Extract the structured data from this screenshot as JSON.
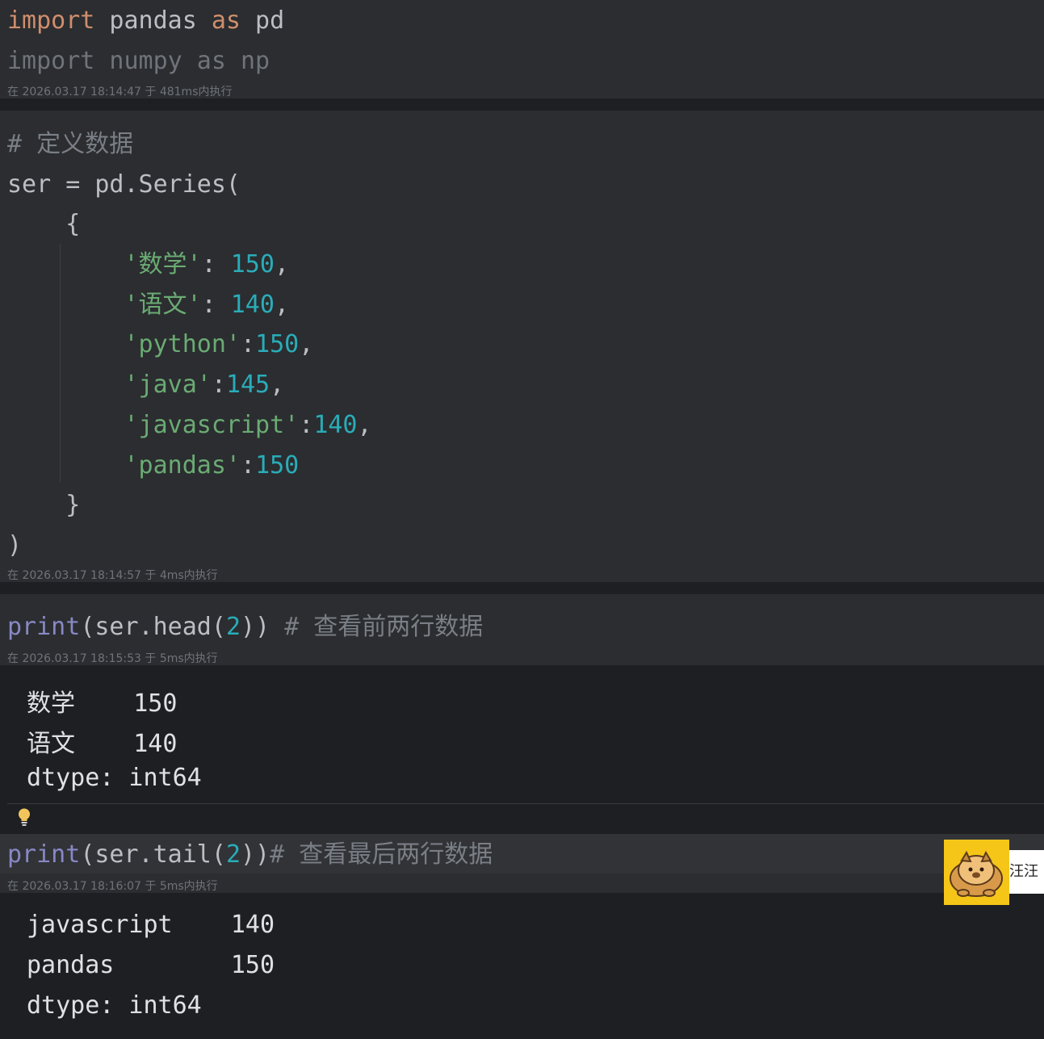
{
  "cells": [
    {
      "lines": [
        [
          {
            "t": "import",
            "c": "kw"
          },
          {
            "t": " pandas ",
            "c": "plain"
          },
          {
            "t": "as",
            "c": "kw"
          },
          {
            "t": " pd",
            "c": "plain"
          }
        ],
        [
          {
            "t": "import numpy as np",
            "c": "dim"
          }
        ]
      ],
      "meta": "在 2026.03.17 18:14:47 于 481ms内执行"
    },
    {
      "lines": [
        [
          {
            "t": "# 定义数据",
            "c": "comment"
          }
        ],
        [
          {
            "t": "ser = pd.Series(",
            "c": "plain"
          }
        ],
        [
          {
            "t": "    {",
            "c": "plain"
          }
        ],
        [
          {
            "t": "        ",
            "c": "plain"
          },
          {
            "t": "'数学'",
            "c": "str"
          },
          {
            "t": ": ",
            "c": "plain"
          },
          {
            "t": "150",
            "c": "num"
          },
          {
            "t": ",",
            "c": "plain"
          }
        ],
        [
          {
            "t": "        ",
            "c": "plain"
          },
          {
            "t": "'语文'",
            "c": "str"
          },
          {
            "t": ": ",
            "c": "plain"
          },
          {
            "t": "140",
            "c": "num"
          },
          {
            "t": ",",
            "c": "plain"
          }
        ],
        [
          {
            "t": "        ",
            "c": "plain"
          },
          {
            "t": "'python'",
            "c": "str"
          },
          {
            "t": ":",
            "c": "plain"
          },
          {
            "t": "150",
            "c": "num"
          },
          {
            "t": ",",
            "c": "plain"
          }
        ],
        [
          {
            "t": "        ",
            "c": "plain"
          },
          {
            "t": "'java'",
            "c": "str"
          },
          {
            "t": ":",
            "c": "plain"
          },
          {
            "t": "145",
            "c": "num"
          },
          {
            "t": ",",
            "c": "plain"
          }
        ],
        [
          {
            "t": "        ",
            "c": "plain"
          },
          {
            "t": "'javascript'",
            "c": "str"
          },
          {
            "t": ":",
            "c": "plain"
          },
          {
            "t": "140",
            "c": "num"
          },
          {
            "t": ",",
            "c": "plain"
          }
        ],
        [
          {
            "t": "        ",
            "c": "plain"
          },
          {
            "t": "'pandas'",
            "c": "str"
          },
          {
            "t": ":",
            "c": "plain"
          },
          {
            "t": "150",
            "c": "num"
          }
        ],
        [
          {
            "t": "    }",
            "c": "plain"
          }
        ],
        [
          {
            "t": ")",
            "c": "plain"
          }
        ]
      ],
      "meta": "在 2026.03.17 18:14:57 于 4ms内执行"
    },
    {
      "lines": [
        [
          {
            "t": "print",
            "c": "fn"
          },
          {
            "t": "(ser.head(",
            "c": "plain"
          },
          {
            "t": "2",
            "c": "num"
          },
          {
            "t": ")) ",
            "c": "plain"
          },
          {
            "t": "# 查看前两行数据",
            "c": "comment"
          }
        ]
      ],
      "meta": "在 2026.03.17 18:15:53 于 5ms内执行",
      "output": [
        "数学    150",
        "语文    140",
        "dtype: int64"
      ]
    },
    {
      "lines": [
        [
          {
            "t": "print",
            "c": "fn"
          },
          {
            "t": "(ser.tail(",
            "c": "plain"
          },
          {
            "t": "2",
            "c": "num"
          },
          {
            "t": "))",
            "c": "plain"
          },
          {
            "t": "# 查看最后两行数据",
            "c": "comment"
          }
        ]
      ],
      "meta": "在 2026.03.17 18:16:07 于 5ms内执行",
      "output": [
        "javascript    140",
        "pandas        150",
        "dtype: int64"
      ]
    }
  ],
  "widget": {
    "label": "汪汪",
    "icon": "dog-mascot-icon",
    "bg_color": "#f5c518"
  },
  "icons": {
    "hint": "lightbulb-icon"
  }
}
